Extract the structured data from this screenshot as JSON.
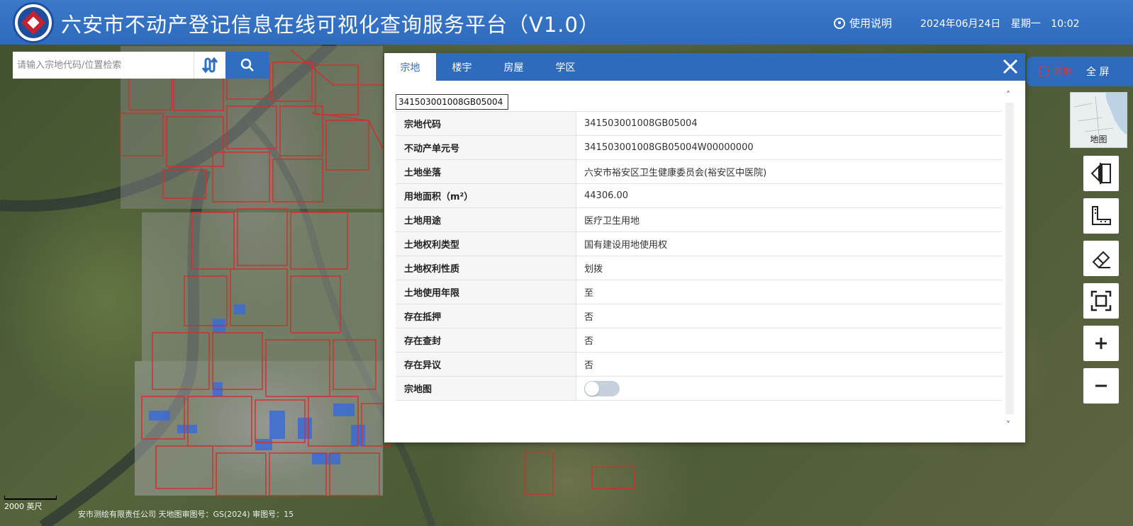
{
  "header": {
    "title": "六安市不动产登记信息在线可视化查询服务平台（V1.0）",
    "help_label": "使用说明",
    "date": "2024年06月24日",
    "weekday": "星期一",
    "time": "10:02"
  },
  "search": {
    "placeholder": "请输入宗地代码/位置检索"
  },
  "modebar": {
    "parcel_label": "宗地",
    "fullscreen_label": "全 屏"
  },
  "minimap": {
    "label": "地图"
  },
  "tools": [
    "swipe-icon",
    "measure-icon",
    "clear-icon",
    "extent-icon",
    "zoom-in-icon",
    "zoom-out-icon"
  ],
  "panel": {
    "tabs": [
      "宗地",
      "楼宇",
      "房屋",
      "学区"
    ],
    "active_tab": "宗地",
    "parcel_code_value": "341503001008GB05004",
    "rows": [
      {
        "k": "宗地代码",
        "v": "341503001008GB05004"
      },
      {
        "k": "不动产单元号",
        "v": "341503001008GB05004W00000000"
      },
      {
        "k": "土地坐落",
        "v": "六安市裕安区卫生健康委员会(裕安区中医院)"
      },
      {
        "k": "用地面积（m²）",
        "v": "44306.00"
      },
      {
        "k": "土地用途",
        "v": "医疗卫生用地"
      },
      {
        "k": "土地权利类型",
        "v": "国有建设用地使用权"
      },
      {
        "k": "土地权利性质",
        "v": "划拨"
      },
      {
        "k": "土地使用年限",
        "v": "至"
      },
      {
        "k": "存在抵押",
        "v": "否"
      },
      {
        "k": "存在查封",
        "v": "否"
      },
      {
        "k": "存在异议",
        "v": "否"
      },
      {
        "k": "宗地图",
        "v": ""
      }
    ],
    "toggle_on": false
  },
  "map": {
    "scale_label": "2000 英尺",
    "attribution": "安市测绘有限责任公司    天地图审图号：GS(2024)    审图号：15"
  },
  "colors": {
    "header_blue": "#2f6bbd",
    "parcel_red": "#e3342f"
  }
}
